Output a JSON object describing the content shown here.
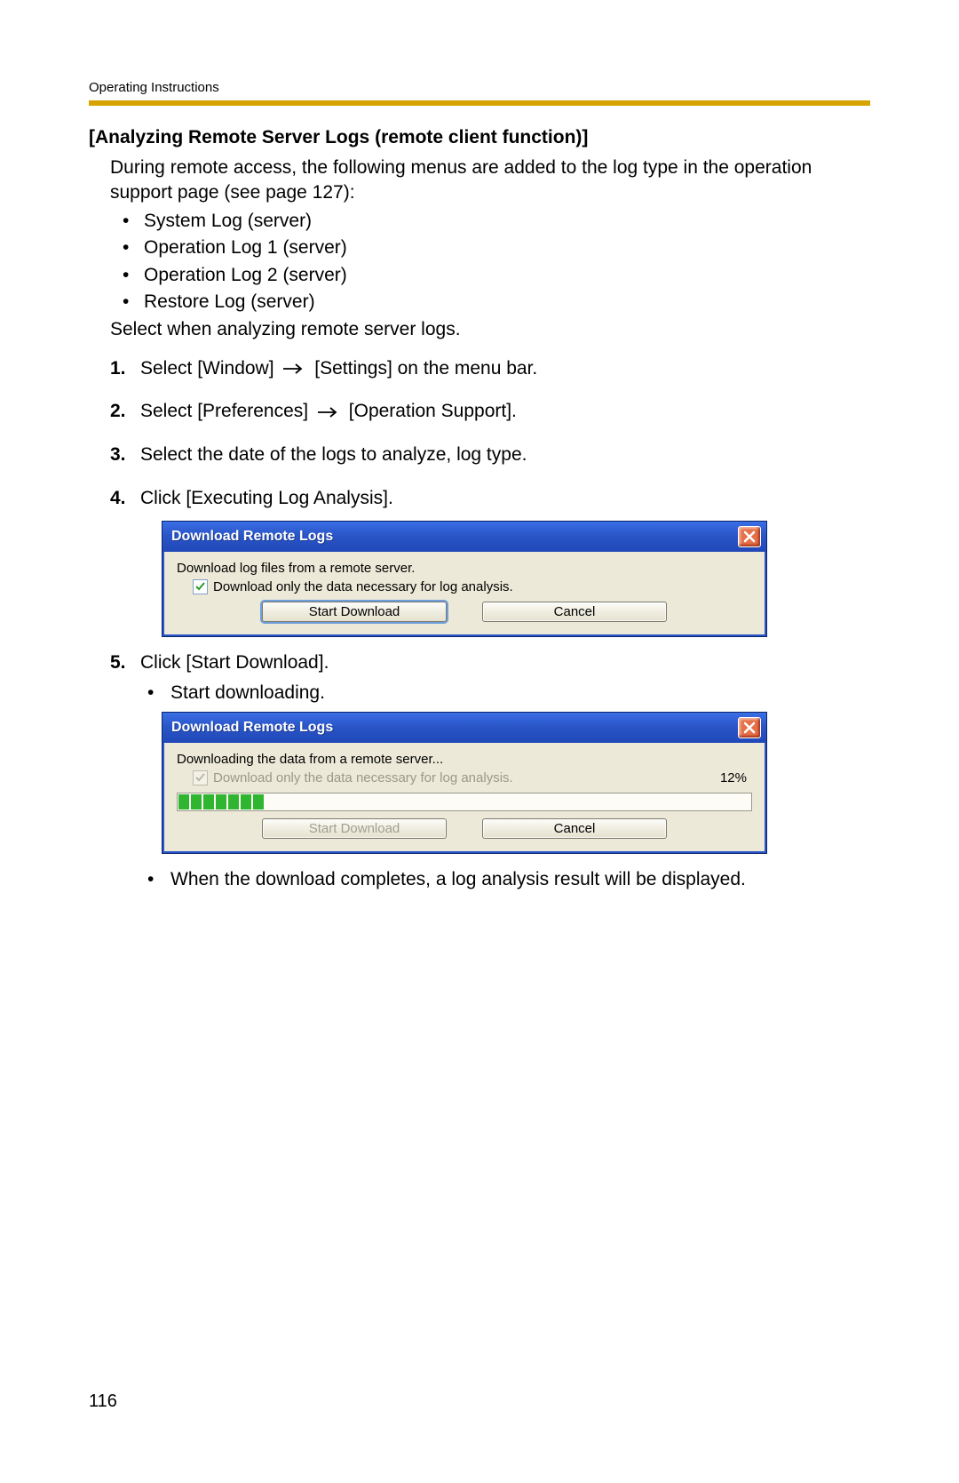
{
  "header": {
    "label": "Operating Instructions"
  },
  "section": {
    "title": "[Analyzing Remote Server Logs (remote client function)]",
    "intro": "During remote access, the following menus are added to the log type in the operation support page (see page 127):",
    "bullets": [
      "System Log (server)",
      "Operation Log 1 (server)",
      "Operation Log 2 (server)",
      "Restore Log (server)"
    ],
    "afterBullets": "Select when analyzing remote server logs."
  },
  "steps": [
    {
      "num": "1.",
      "before": "Select [Window]",
      "after": "[Settings] on the menu bar."
    },
    {
      "num": "2.",
      "before": "Select [Preferences]",
      "after": "[Operation Support]."
    },
    {
      "num": "3.",
      "text": "Select the date of the logs to analyze, log type."
    },
    {
      "num": "4.",
      "text": "Click [Executing Log Analysis]."
    },
    {
      "num": "5.",
      "text": "Click [Start Download].",
      "sub1": "Start downloading.",
      "sub2": "When the download completes, a log analysis result will be displayed."
    }
  ],
  "dialog1": {
    "title": "Download Remote Logs",
    "line1": "Download log files from a remote server.",
    "checkboxLabel": "Download only the data necessary for log analysis.",
    "startBtn": "Start Download",
    "cancelBtn": "Cancel"
  },
  "dialog2": {
    "title": "Download Remote Logs",
    "line1": "Downloading the data from a remote server...",
    "checkboxLabel": "Download only the data necessary for log analysis.",
    "percent": "12%",
    "startBtn": "Start Download",
    "cancelBtn": "Cancel"
  },
  "pageNumber": "116"
}
